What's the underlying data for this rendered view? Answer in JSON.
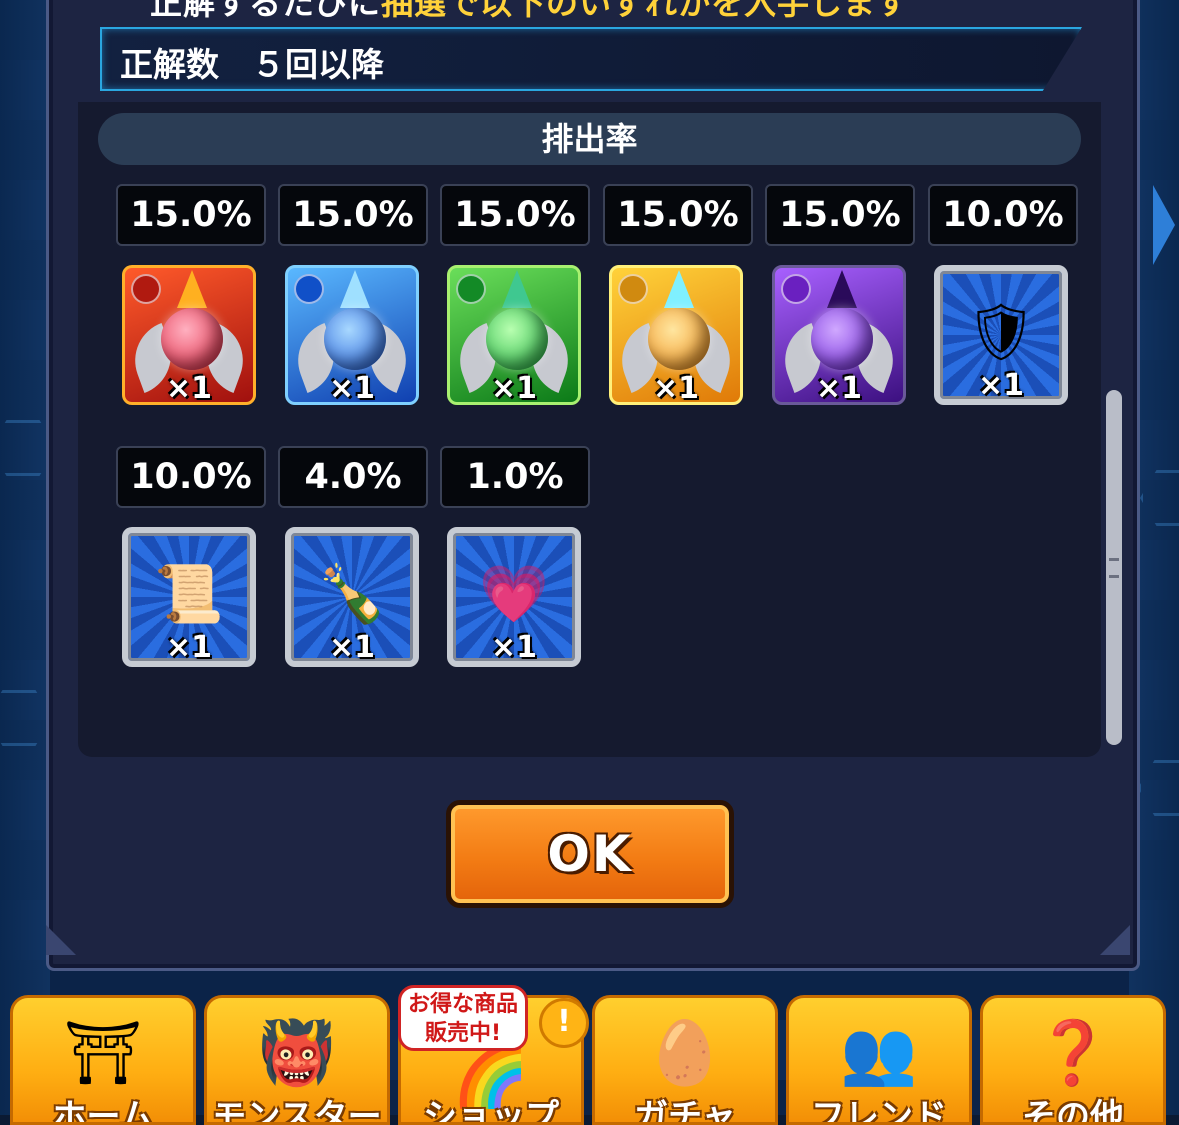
{
  "header": {
    "line_prefix": "正解するたびに",
    "line_highlight": "抽選で以下のいずれかを入手します",
    "count_label": "正解数　５回以降"
  },
  "rates": {
    "title": "排出率",
    "items": [
      {
        "percent": "15.0%",
        "qty": "×1",
        "icon": "fire-orb-icon",
        "color": "#d8301a"
      },
      {
        "percent": "15.0%",
        "qty": "×1",
        "icon": "water-orb-icon",
        "color": "#1a72e0"
      },
      {
        "percent": "15.0%",
        "qty": "×1",
        "icon": "wood-orb-icon",
        "color": "#18a42c"
      },
      {
        "percent": "15.0%",
        "qty": "×1",
        "icon": "light-orb-icon",
        "color": "#f0a010"
      },
      {
        "percent": "15.0%",
        "qty": "×1",
        "icon": "dark-orb-icon",
        "color": "#7a2ed0"
      },
      {
        "percent": "10.0%",
        "qty": "×1",
        "icon": "silver-emblem-icon",
        "color": "#1b4fb8"
      },
      {
        "percent": "10.0%",
        "qty": "×1",
        "icon": "scroll-icon",
        "color": "#1b4fb8"
      },
      {
        "percent": "4.0%",
        "qty": "×1",
        "icon": "growth-potion-icon",
        "color": "#1b4fb8"
      },
      {
        "percent": "1.0%",
        "qty": "×1",
        "icon": "heart-potion-icon",
        "color": "#1b4fb8"
      }
    ]
  },
  "ok_button": "OK",
  "nav": {
    "promo_line1": "お得な商品",
    "promo_line2": "販売中!",
    "promo_badge": "!",
    "tabs": [
      {
        "label": "ホーム",
        "icon": "home-gate-icon"
      },
      {
        "label": "モンスター",
        "icon": "monster-icon"
      },
      {
        "label": "ショップ",
        "icon": "rainbow-orb-icon"
      },
      {
        "label": "ガチャ",
        "icon": "gacha-egg-icon"
      },
      {
        "label": "フレンド",
        "icon": "friends-icon"
      },
      {
        "label": "その他",
        "icon": "other-question-icon"
      }
    ]
  }
}
